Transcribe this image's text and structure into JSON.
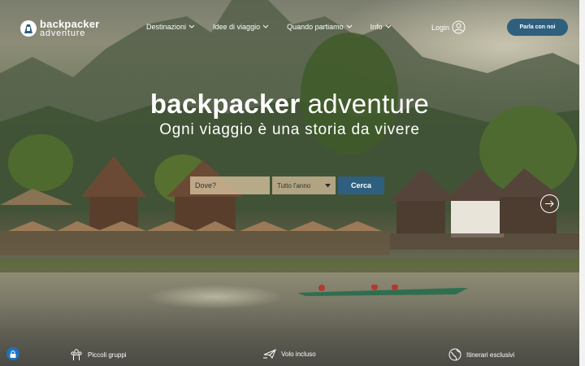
{
  "brand": {
    "line1": "backpacker",
    "line2": "adventure",
    "accent": "#2f5f7e"
  },
  "nav": {
    "items": [
      {
        "label": "Destinazioni",
        "icon": "chevron-down-icon"
      },
      {
        "label": "Idee di viaggio",
        "icon": "chevron-down-icon"
      },
      {
        "label": "Quando partiamo",
        "icon": "chevron-down-icon"
      },
      {
        "label": "Info",
        "icon": "chevron-down-icon"
      }
    ],
    "login_label": "Login",
    "login_icon": "user-icon",
    "cta_label": "Parla con noi"
  },
  "hero": {
    "title_bold": "backpacker",
    "title_light": "adventure",
    "subtitle": "Ogni viaggio è una storia da vivere"
  },
  "search": {
    "where_placeholder": "Dove?",
    "when_value": "Tutto l'anno",
    "submit_label": "Cerca"
  },
  "features": [
    {
      "label": "Piccoli gruppi",
      "icon": "group-icon"
    },
    {
      "label": "Volo incluso",
      "icon": "plane-icon"
    },
    {
      "label": "Itinerari esclusivi",
      "icon": "globe-icon"
    }
  ],
  "widgets": {
    "lock_color": "#1e73be"
  }
}
